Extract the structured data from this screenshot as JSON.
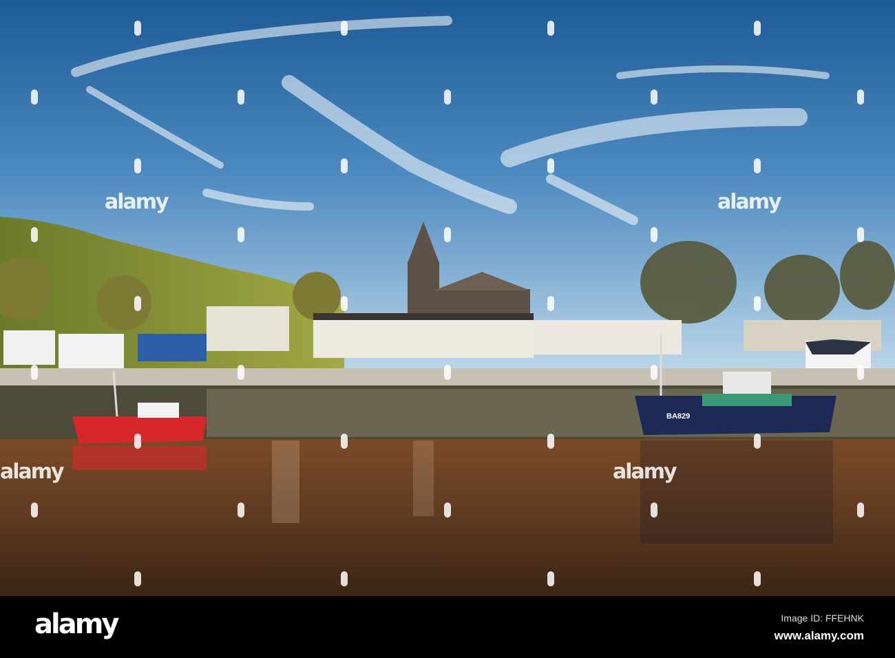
{
  "photo": {
    "boat_registration": "BA829",
    "colors": {
      "sky_top": "#1f5f9c",
      "sky_bottom": "#b9d3e6",
      "water": "#6b3d20",
      "red_boat": "#d8272a",
      "blue_boat": "#1c2a55"
    }
  },
  "watermark": {
    "text": "alamy"
  },
  "footer": {
    "logo": "alamy",
    "image_id": "Image ID: FFEHNK",
    "url": "www.alamy.com"
  }
}
